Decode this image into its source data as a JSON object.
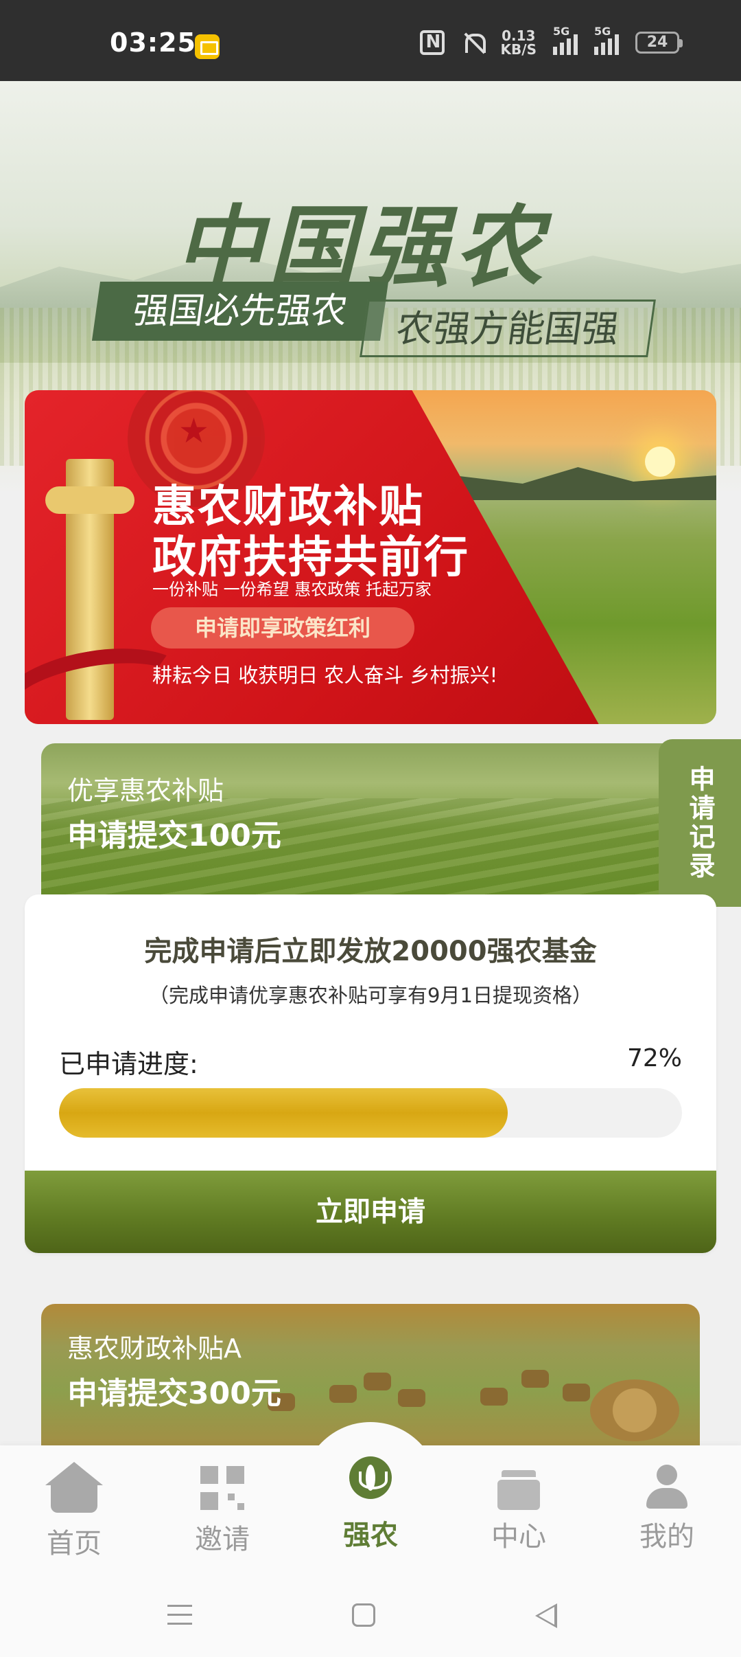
{
  "status_bar": {
    "time": "03:25",
    "net_speed_value": "0.13",
    "net_speed_unit": "KB/S",
    "signal1_label": "5G",
    "signal2_label": "5G",
    "battery": "24",
    "icons": [
      "mail-notification-icon",
      "nfc-icon",
      "mute-icon",
      "signal-icon",
      "signal-icon",
      "battery-icon"
    ]
  },
  "hero": {
    "title": "中国强农",
    "slogan_left": "强国必先强农",
    "slogan_right": "农强方能国强"
  },
  "banner": {
    "title_line1": "惠农财政补贴",
    "title_line2": "政府扶持共前行",
    "subtitle": "一份补贴 一份希望 惠农政策 托起万家",
    "pill": "申请即享政策红利",
    "footer": "耕耘今日 收获明日 农人奋斗 乡村振兴!"
  },
  "subsidy_cards": [
    {
      "label": "优享惠农补贴",
      "amount": "申请提交100元"
    },
    {
      "label": "惠农财政补贴A",
      "amount": "申请提交300元"
    }
  ],
  "apply_record_tab": "申请记录",
  "progress_card": {
    "title": "完成申请后立即发放20000强农基金",
    "note": "（完成申请优享惠农补贴可享有9月1日提现资格）",
    "progress_label": "已申请进度:",
    "progress_percent_text": "72%",
    "progress_value": 0.72,
    "button": "立即申请"
  },
  "bottom_nav": {
    "items": [
      {
        "label": "首页",
        "icon": "home-icon",
        "active": false
      },
      {
        "label": "邀请",
        "icon": "qr-code-icon",
        "active": false
      },
      {
        "label": "强农",
        "icon": "sprout-icon",
        "active": true
      },
      {
        "label": "中心",
        "icon": "box-icon",
        "active": false
      },
      {
        "label": "我的",
        "icon": "user-icon",
        "active": false
      }
    ]
  },
  "colors": {
    "primary_green": "#5f7d35",
    "gold": "#d8a713",
    "banner_red": "#cf1318"
  }
}
